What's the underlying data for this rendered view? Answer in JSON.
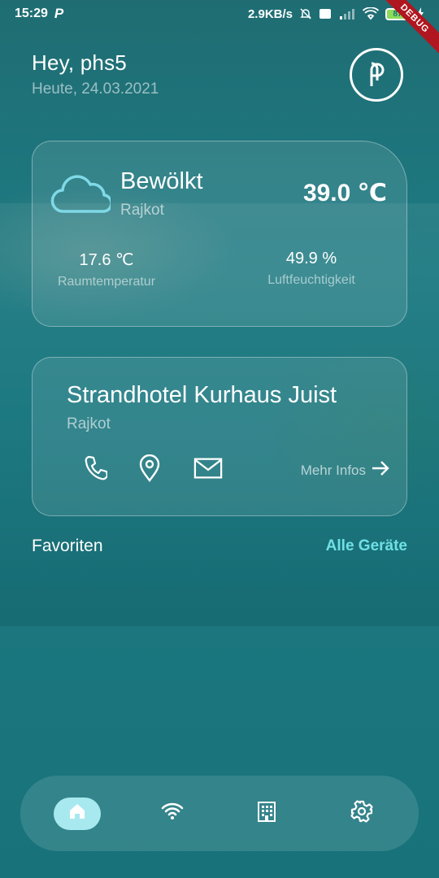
{
  "status_bar": {
    "time": "15:29",
    "app_glyph": "P",
    "net_speed": "2.9KB/s",
    "battery": "87",
    "debug": "DEBUG"
  },
  "header": {
    "greeting": "Hey, phs5",
    "date": "Heute, 24.03.2021",
    "logo_icon": "phs-logo-icon"
  },
  "weather": {
    "condition": "Bewölkt",
    "city": "Rajkot",
    "temperature": "39.0 ℃",
    "room_temp_value": "17.6 ℃",
    "room_temp_label": "Raumtemperatur",
    "humidity_value": "49.9 %",
    "humidity_label": "Luftfeuchtigkeit",
    "icon": "cloud-icon",
    "accent": "#7fd9e6"
  },
  "hotel": {
    "name": "Strandhotel Kurhaus Juist",
    "city": "Rajkot",
    "more_label": "Mehr Infos",
    "icons": [
      "phone-icon",
      "location-pin-icon",
      "mail-icon",
      "arrow-right-icon"
    ]
  },
  "favorites": {
    "title": "Favoriten",
    "all_devices": "Alle Geräte",
    "link_color": "#6fe0e6"
  },
  "navbar": {
    "items": [
      {
        "icon": "home-icon",
        "active": true
      },
      {
        "icon": "wifi-icon",
        "active": false
      },
      {
        "icon": "building-icon",
        "active": false
      },
      {
        "icon": "settings-gear-icon",
        "active": false
      }
    ],
    "active_color": "#a7e9ef"
  }
}
